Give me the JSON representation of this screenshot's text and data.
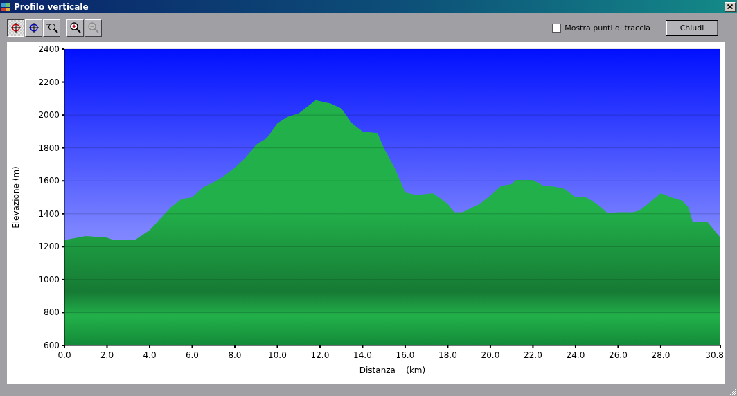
{
  "window": {
    "title": "Profilo verticale"
  },
  "toolbar": {
    "tools": [
      {
        "kind": "cursor-red",
        "selected": true,
        "disabled": false
      },
      {
        "kind": "cursor-blue",
        "selected": false,
        "disabled": false
      },
      {
        "kind": "zoom-area",
        "selected": false,
        "disabled": false
      },
      {
        "kind": "zoom-in",
        "selected": false,
        "disabled": false
      },
      {
        "kind": "zoom-out",
        "selected": false,
        "disabled": true
      }
    ],
    "checkbox": {
      "label": "Mostra punti di traccia",
      "checked": false
    },
    "buttons": [
      "Chiudi"
    ]
  },
  "chart": {
    "chart_data": {
      "type": "area",
      "xlabel": "Distanza    (km)",
      "ylabel": "Elevazione (m)",
      "x": [
        0,
        1,
        2,
        2.3,
        3.3,
        4,
        4.5,
        5,
        5.5,
        6,
        6.5,
        7,
        7.5,
        8,
        8.5,
        9,
        9.5,
        10,
        10.5,
        11,
        11.5,
        11.8,
        12.5,
        13,
        13.5,
        14,
        14.7,
        15,
        15.5,
        16,
        16.5,
        17,
        17.3,
        17.7,
        18,
        18.3,
        18.7,
        19.5,
        20,
        20.5,
        21,
        21.2,
        22,
        22.5,
        23,
        23.5,
        24,
        24.5,
        25,
        25.5,
        26,
        26.7,
        27,
        27.5,
        28,
        28.5,
        29,
        29.3,
        29.5,
        30.2,
        30.8
      ],
      "grid": true,
      "series": [
        {
          "color": "#22b04a",
          "values": [
            1240,
            1265,
            1255,
            1240,
            1240,
            1300,
            1370,
            1440,
            1490,
            1500,
            1560,
            1590,
            1630,
            1680,
            1740,
            1820,
            1860,
            1950,
            1990,
            2010,
            2060,
            2090,
            2070,
            2040,
            1950,
            1900,
            1890,
            1800,
            1680,
            1530,
            1515,
            1520,
            1525,
            1490,
            1460,
            1410,
            1410,
            1460,
            1510,
            1570,
            1580,
            1605,
            1605,
            1570,
            1565,
            1550,
            1500,
            1500,
            1460,
            1405,
            1410,
            1410,
            1420,
            1470,
            1525,
            1500,
            1480,
            1440,
            1350,
            1350,
            1255
          ]
        }
      ],
      "xlim": [
        0,
        30.8
      ],
      "ylim": [
        600,
        2400
      ],
      "xticks": [
        {
          "value": 0,
          "label": "0.0"
        },
        {
          "value": 2,
          "label": "2.0"
        },
        {
          "value": 4,
          "label": "4.0"
        },
        {
          "value": 6,
          "label": "6.0"
        },
        {
          "value": 8,
          "label": "8.0"
        },
        {
          "value": 10,
          "label": "10.0"
        },
        {
          "value": 12,
          "label": "12.0"
        },
        {
          "value": 14,
          "label": "14.0"
        },
        {
          "value": 16,
          "label": "16.0"
        },
        {
          "value": 18,
          "label": "18.0"
        },
        {
          "value": 20,
          "label": "20.0"
        },
        {
          "value": 22,
          "label": "22.0"
        },
        {
          "value": 24,
          "label": "24.0"
        },
        {
          "value": 26,
          "label": "26.0"
        },
        {
          "value": 28,
          "label": "28.0"
        },
        {
          "value": 30.8,
          "label": "30.8"
        }
      ],
      "yticks": [
        600,
        800,
        1000,
        1200,
        1400,
        1600,
        1800,
        2000,
        2200,
        2400
      ]
    }
  }
}
